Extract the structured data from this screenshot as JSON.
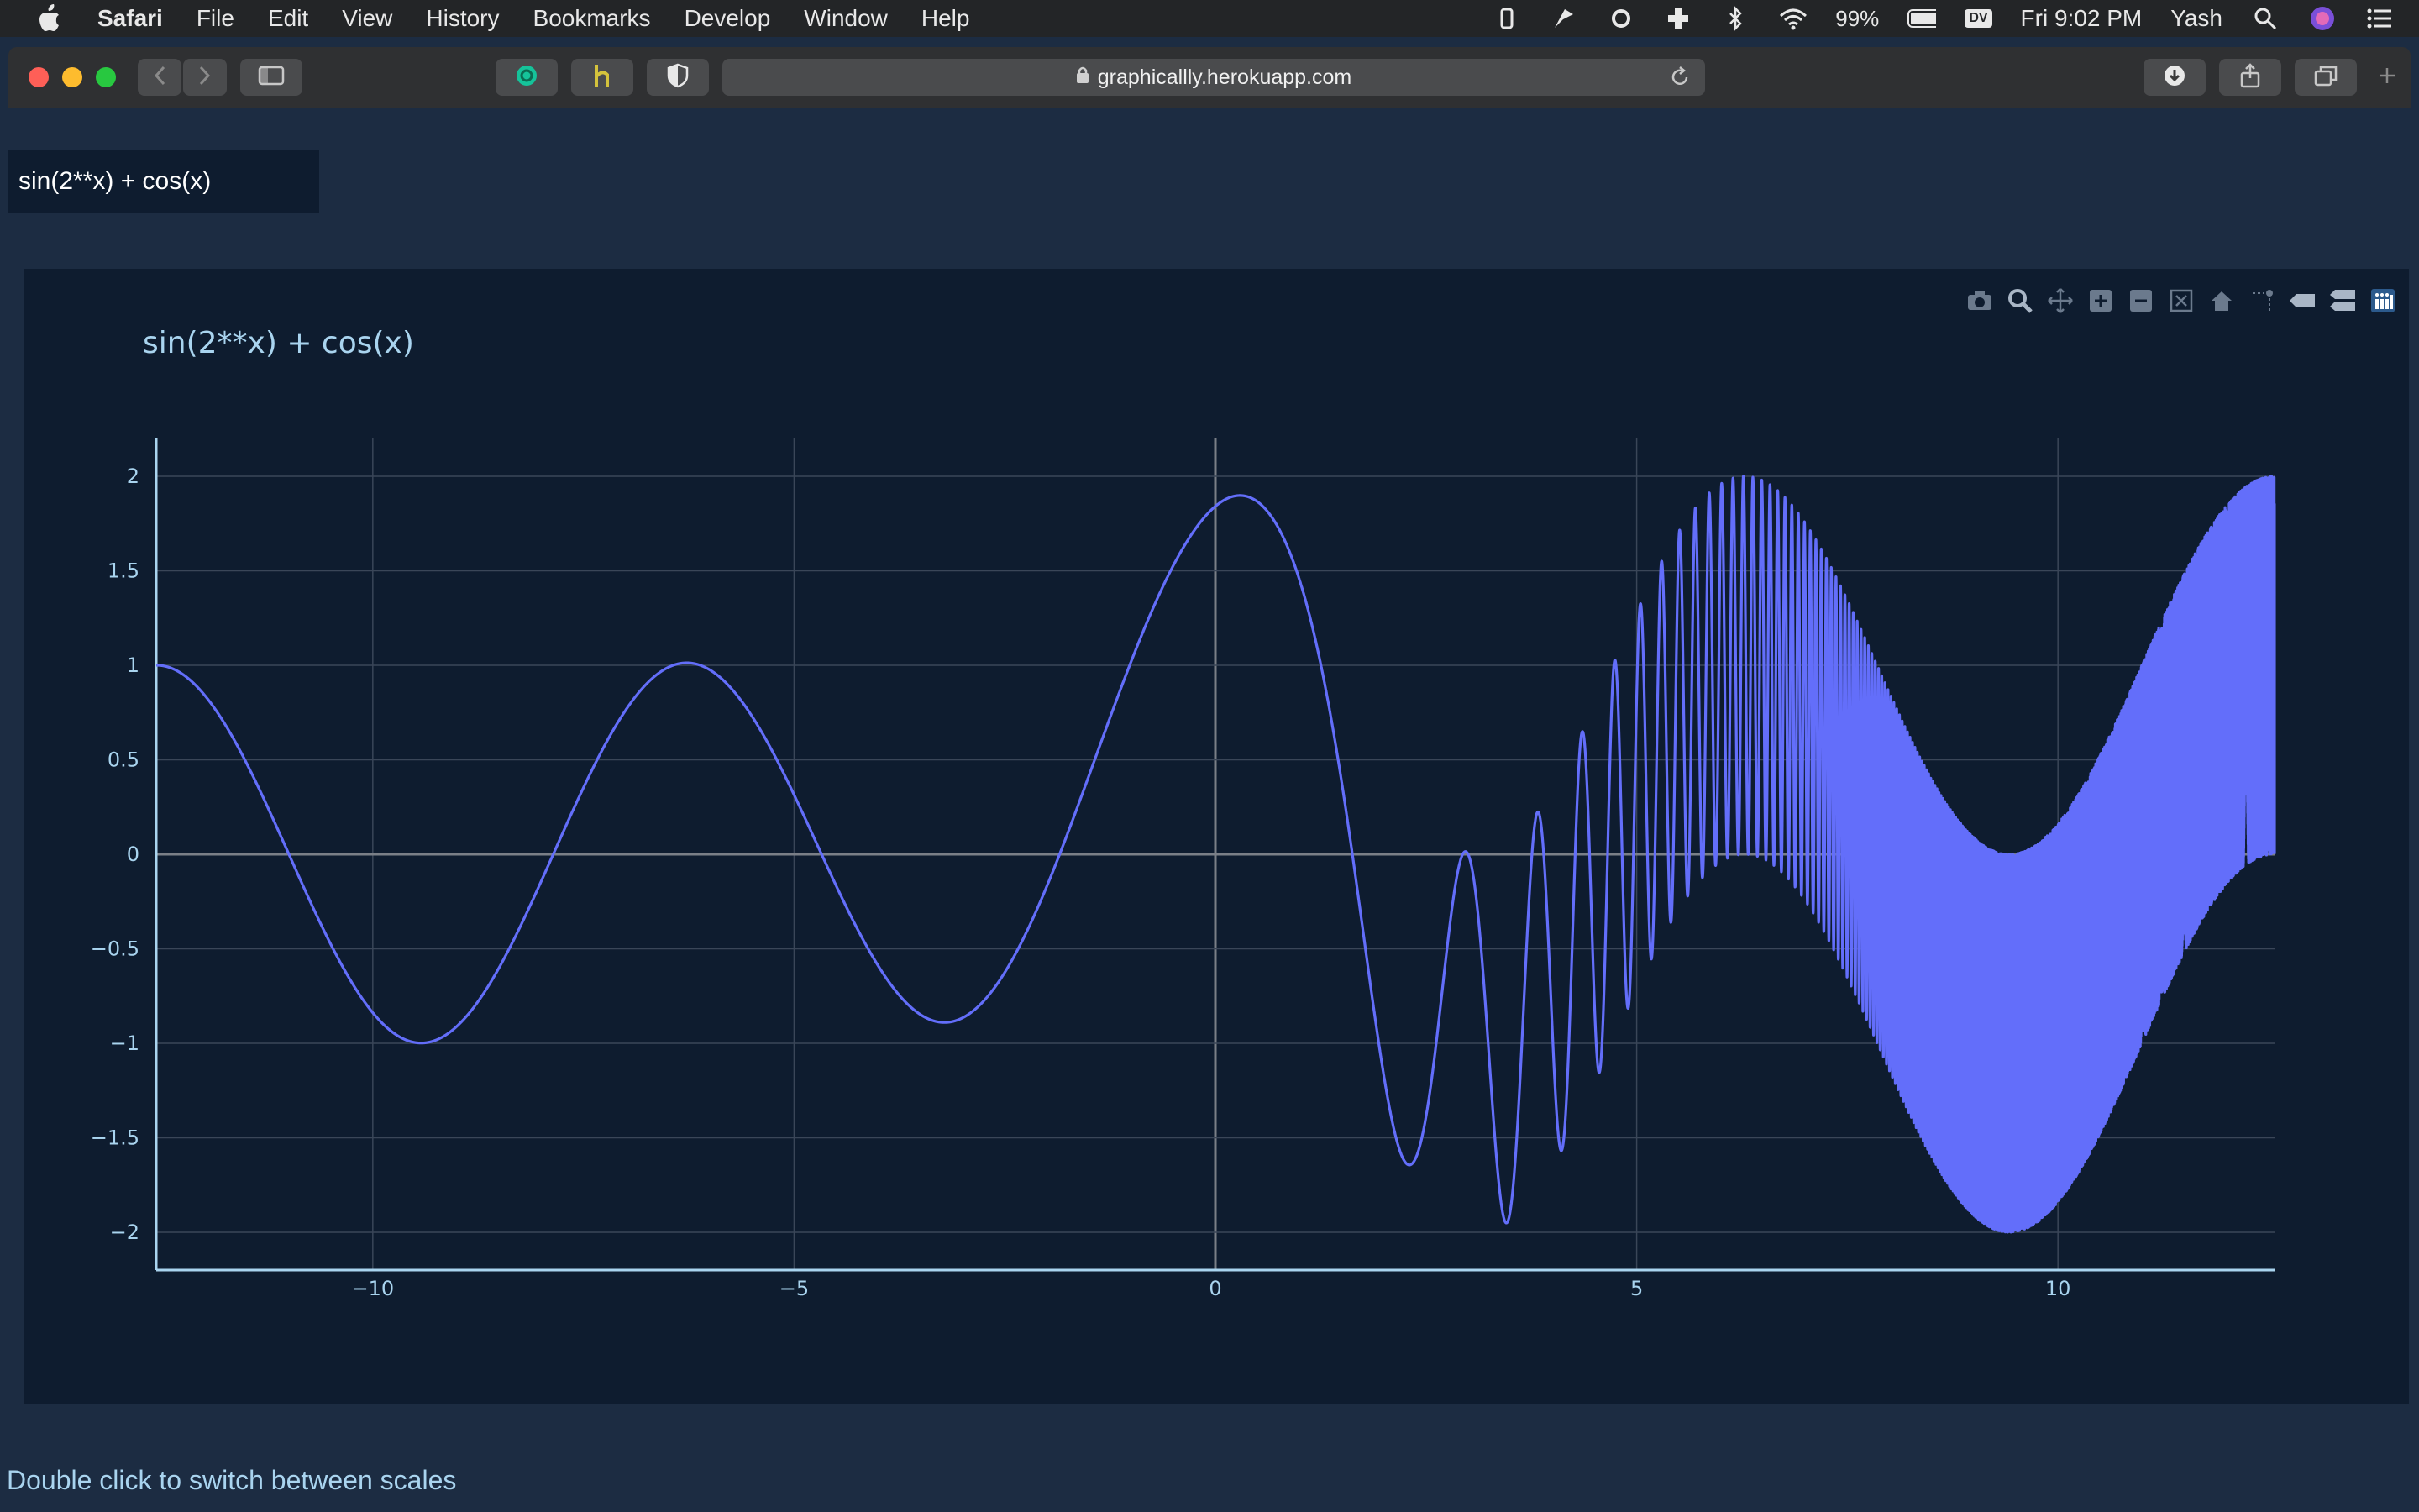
{
  "menubar": {
    "items": [
      "Safari",
      "File",
      "Edit",
      "View",
      "History",
      "Bookmarks",
      "Develop",
      "Window",
      "Help"
    ],
    "battery": "99%",
    "datetime": "Fri 9:02 PM",
    "user": "Yash",
    "badge": "DV"
  },
  "browser": {
    "url": "graphicallly.herokuapp.com"
  },
  "page": {
    "formula_input_value": "sin(2**x) + cos(x)",
    "footer_hint": "Double click to switch between scales"
  },
  "colors": {
    "page_bg": "#1c2c42",
    "plot_bg": "#0e1c2f",
    "line": "#636efa",
    "axis": "#a9d4ef",
    "grid": "#3a4658",
    "zeroline": "#7a7f87"
  },
  "chart_data": {
    "type": "line",
    "title": "sin(2**x) + cos(x)",
    "expression": "sin(2**x) + cos(x)",
    "xlim": [
      -12.57,
      12.57
    ],
    "ylim": [
      -2.2,
      2.2
    ],
    "xticks": [
      -10,
      -5,
      0,
      5,
      10
    ],
    "xtick_labels": [
      "−10",
      "−5",
      "0",
      "5",
      "10"
    ],
    "yticks": [
      2,
      1.5,
      1,
      0.5,
      0,
      -0.5,
      -1,
      -1.5,
      -2
    ],
    "ytick_labels": [
      "2",
      "1.5",
      "1",
      "0.5",
      "0",
      "−0.5",
      "−1",
      "−1.5",
      "−2"
    ],
    "grid": true,
    "series": [
      {
        "color": "#636efa"
      }
    ]
  }
}
